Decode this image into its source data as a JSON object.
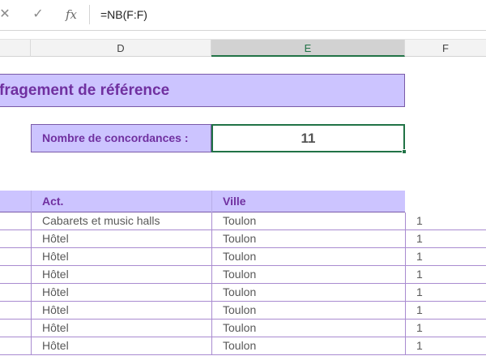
{
  "formula_bar": {
    "cancel_icon": "✕",
    "enter_icon": "✓",
    "fx_label": "fx",
    "formula": "=NB(F:F)"
  },
  "columns": {
    "c": "",
    "d": "D",
    "e": "E",
    "f": "F"
  },
  "sheet": {
    "title": "fragement de référence",
    "match_label": "Nombre de concordances :",
    "match_value": "11",
    "headers": {
      "act": "Act.",
      "ville": "Ville"
    },
    "rows": [
      {
        "act": "Cabarets et music halls",
        "ville": "Toulon",
        "f": "1"
      },
      {
        "act": "Hôtel",
        "ville": "Toulon",
        "f": "1"
      },
      {
        "act": "Hôtel",
        "ville": "Toulon",
        "f": "1"
      },
      {
        "act": "Hôtel",
        "ville": "Toulon",
        "f": "1"
      },
      {
        "act": "Hôtel",
        "ville": "Toulon",
        "f": "1"
      },
      {
        "act": "Hôtel",
        "ville": "Toulon",
        "f": "1"
      },
      {
        "act": "Hôtel",
        "ville": "Toulon",
        "f": "1"
      },
      {
        "act": "Hôtel",
        "ville": "Toulon",
        "f": "1"
      }
    ]
  }
}
